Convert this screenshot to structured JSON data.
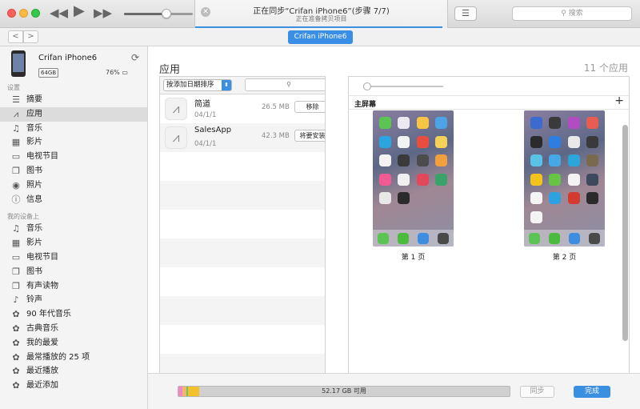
{
  "titlebar": {
    "sync_title": "正在同步“Crifan iPhone6”(步骤 7/7)",
    "sync_subtitle": "正在准备拷贝项目",
    "sync_progress": 0.98,
    "volume_level": 0.62,
    "search_placeholder": "搜索",
    "icons": {
      "rewind": "rewind-icon",
      "play": "play-icon",
      "fast_forward": "fast-forward-icon",
      "close": "close-icon",
      "list": "list-icon",
      "search": "search-icon"
    }
  },
  "navbar": {
    "back": "<",
    "forward": ">",
    "device_pill": "Crifan iPhone6"
  },
  "device": {
    "name": "Crifan iPhone6",
    "capacity": "64GB",
    "battery": "76%"
  },
  "sidebar": {
    "settings_header": "设置",
    "settings": [
      {
        "label": "摘要",
        "icon": "summary-icon",
        "glyph": "☰",
        "selected": false
      },
      {
        "label": "应用",
        "icon": "apps-icon",
        "glyph": "⩘",
        "selected": true
      },
      {
        "label": "音乐",
        "icon": "music-icon",
        "glyph": "♫",
        "selected": false
      },
      {
        "label": "影片",
        "icon": "movies-icon",
        "glyph": "▦",
        "selected": false
      },
      {
        "label": "电视节目",
        "icon": "tv-icon",
        "glyph": "▭",
        "selected": false
      },
      {
        "label": "图书",
        "icon": "books-icon",
        "glyph": "❐",
        "selected": false
      },
      {
        "label": "照片",
        "icon": "camera-icon",
        "glyph": "◉",
        "selected": false
      },
      {
        "label": "信息",
        "icon": "info-icon",
        "glyph": "ⓘ",
        "selected": false
      }
    ],
    "mydevice_header": "我的设备上",
    "mydevice": [
      {
        "label": "音乐",
        "icon": "music-icon",
        "glyph": "♫"
      },
      {
        "label": "影片",
        "icon": "movies-icon",
        "glyph": "▦"
      },
      {
        "label": "电视节目",
        "icon": "tv-icon",
        "glyph": "▭"
      },
      {
        "label": "图书",
        "icon": "books-icon",
        "glyph": "❐"
      },
      {
        "label": "有声读物",
        "icon": "audiobooks-icon",
        "glyph": "❐"
      },
      {
        "label": "铃声",
        "icon": "bell-icon",
        "glyph": "♪"
      },
      {
        "label": "90 年代音乐",
        "icon": "gear-icon",
        "glyph": "✿"
      },
      {
        "label": "古典音乐",
        "icon": "gear-icon",
        "glyph": "✿"
      },
      {
        "label": "我的最爱",
        "icon": "gear-icon",
        "glyph": "✿"
      },
      {
        "label": "最常播放的 25 项",
        "icon": "gear-icon",
        "glyph": "✿"
      },
      {
        "label": "最近播放",
        "icon": "gear-icon",
        "glyph": "✿"
      },
      {
        "label": "最近添加",
        "icon": "gear-icon",
        "glyph": "✿"
      }
    ]
  },
  "main": {
    "title": "应用",
    "count": "11 个应用",
    "sort_label": "按添加日期排序",
    "apps": [
      {
        "name": "简道",
        "date": "04/1/1",
        "size": "26.5 MB",
        "action": "移除"
      },
      {
        "name": "SalesApp",
        "date": "04/1/1",
        "size": "42.3 MB",
        "action": "将要安装"
      }
    ],
    "home_screen_label": "主屏幕",
    "add": "+",
    "zoom_level": 0.05,
    "pages": [
      {
        "label": "第 1 页",
        "tiles": [
          "#5bc554",
          "#eceaf0",
          "#f7c543",
          "#4ea3e6",
          "#2ba5df",
          "#f2f2f2",
          "#e94d40",
          "#f4d25a",
          "#f3f3f3",
          "#3a3a3a",
          "#4c4c4c",
          "#f2a03d",
          "#f25a93",
          "#f0f0f0",
          "#e3475b",
          "#3aa36a",
          "#e8e8e8",
          "#2b2b2b"
        ],
        "dock": [
          "#5bc554",
          "#4bbb3e",
          "#3d8de0",
          "#4a4a4a"
        ]
      },
      {
        "label": "第 2 页",
        "tiles": [
          "#3b6ad0",
          "#3a3a3a",
          "#b14cc2",
          "#e85d52",
          "#2b2b2b",
          "#2d7ee0",
          "#e8e8e8",
          "#3a3a3a",
          "#5ac2e6",
          "#46a8e6",
          "#2ca5da",
          "#7a6a4d",
          "#f2c21d",
          "#67c343",
          "#f3f3f3",
          "#3d4a5e",
          "#f4f4f4",
          "#2ea1e0",
          "#d43b30",
          "#2b2b2b",
          "#f4f4f4"
        ],
        "dock": [
          "#5bc554",
          "#4bbb3e",
          "#3d8de0",
          "#4a4a4a"
        ]
      }
    ]
  },
  "footer": {
    "storage": "52.17 GB 可用",
    "storage_segments": [
      {
        "color": "#f188c5",
        "fraction": 0.012
      },
      {
        "color": "#f7b46b",
        "fraction": 0.012
      },
      {
        "color": "#62c96c",
        "fraction": 0.005
      },
      {
        "color": "#f2c12b",
        "fraction": 0.034
      }
    ],
    "sync_button": "同步",
    "done_button": "完成"
  }
}
